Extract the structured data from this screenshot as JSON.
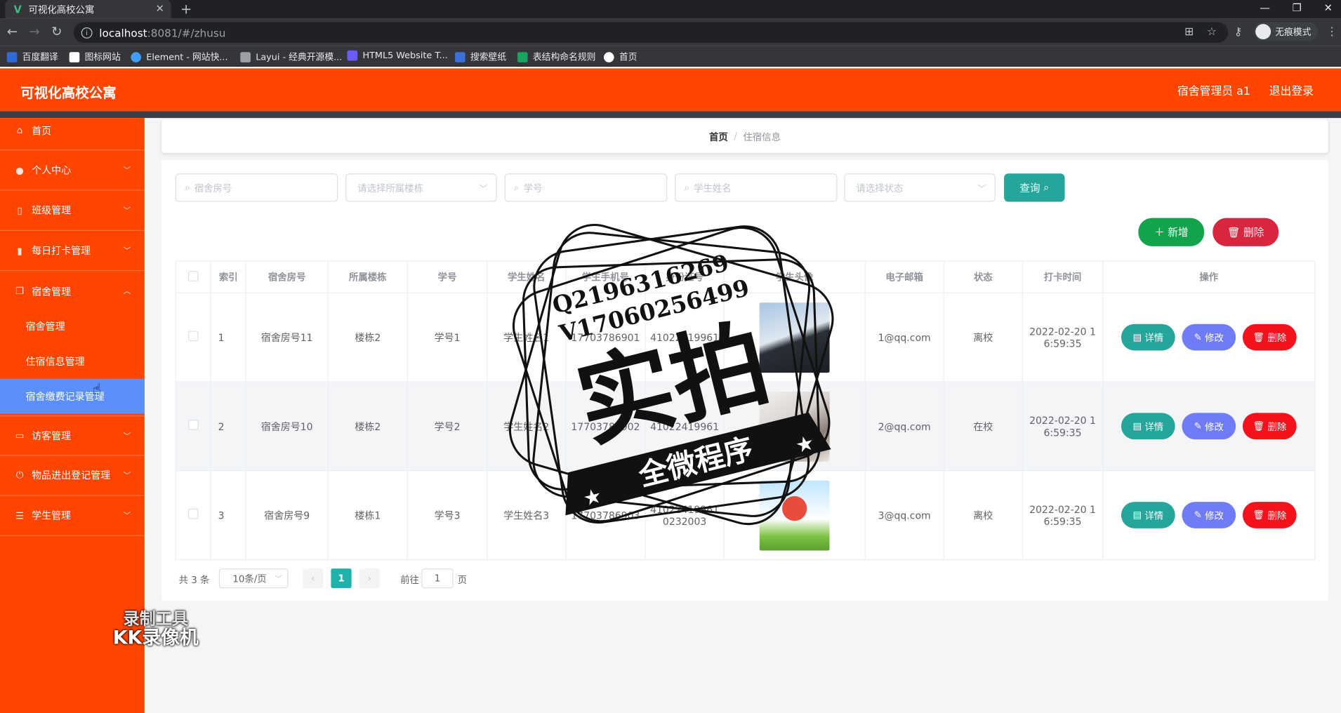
{
  "browser": {
    "tab_title": "可视化高校公寓",
    "url_host": "localhost",
    "url_path": ":8081/#/zhusu",
    "incognito_label": "无痕模式",
    "bookmarks": [
      "百度翻译",
      "图标网站",
      "Element - 网站快...",
      "Layui - 经典开源模...",
      "HTML5 Website T...",
      "搜索壁纸",
      "表结构命名规则",
      "首页"
    ]
  },
  "header": {
    "brand": "可视化高校公寓",
    "user": "宿舍管理员 a1",
    "logout": "退出登录"
  },
  "sidebar": {
    "items": [
      {
        "label": "首页",
        "icon": "home-icon"
      },
      {
        "label": "个人中心",
        "icon": "user-icon"
      },
      {
        "label": "班级管理",
        "icon": "phone-icon"
      },
      {
        "label": "每日打卡管理",
        "icon": "bar-chart-icon"
      },
      {
        "label": "宿舍管理",
        "icon": "copy-icon"
      },
      {
        "label": "访客管理",
        "icon": "monitor-icon"
      },
      {
        "label": "物品进出登记管理",
        "icon": "power-icon"
      },
      {
        "label": "学生管理",
        "icon": "sliders-icon"
      }
    ],
    "subitems": [
      "宿舍管理",
      "住宿信息管理",
      "宿舍缴费记录管理"
    ]
  },
  "breadcrumb": {
    "home": "首页",
    "sep": "/",
    "current": "住宿信息"
  },
  "filters": {
    "room_placeholder": "宿舍房号",
    "building_placeholder": "请选择所属楼栋",
    "student_no_placeholder": "学号",
    "student_name_placeholder": "学生姓名",
    "status_placeholder": "请选择状态",
    "query_label": "查询"
  },
  "actions": {
    "add": "新增",
    "delete": "删除"
  },
  "table": {
    "headers": [
      "索引",
      "宿舍房号",
      "所属楼栋",
      "学号",
      "学生姓名",
      "学生手机号",
      "身份证号",
      "学生头像",
      "电子邮箱",
      "状态",
      "打卡时间",
      "操作"
    ],
    "rows": [
      {
        "index": "1",
        "room": "宿舍房号11",
        "building": "楼栋2",
        "no": "学号1",
        "name": "学生姓名1",
        "phone": "17703786901",
        "id_card": "41022419961",
        "email": "1@qq.com",
        "status": "离校",
        "time1": "2022-02-20 1",
        "time2": "6:59:35"
      },
      {
        "index": "2",
        "room": "宿舍房号10",
        "building": "楼栋2",
        "no": "学号2",
        "name": "学生姓名2",
        "phone": "17703786902",
        "id_card": "41022419961",
        "email": "2@qq.com",
        "status": "在校",
        "time1": "2022-02-20 1",
        "time2": "6:59:35"
      },
      {
        "index": "3",
        "room": "宿舍房号9",
        "building": "楼栋1",
        "no": "学号3",
        "name": "学生姓名3",
        "phone": "17703786903",
        "id_card": "41022419961",
        "id_card2": "0232003",
        "email": "3@qq.com",
        "status": "离校",
        "time1": "2022-02-20 1",
        "time2": "6:59:35"
      }
    ],
    "ops": {
      "detail": "详情",
      "edit": "修改",
      "remove": "删除"
    }
  },
  "pagination": {
    "total": "共 3 条",
    "page_size": "10条/页",
    "current": "1",
    "goto_label": "前往",
    "goto_value": "1",
    "page_unit": "页"
  },
  "watermark": {
    "line1": "Q2196316269",
    "line2": "V17060256499",
    "big": "实拍",
    "ribbon": "全微程序"
  },
  "recorder": {
    "line1": "录制工具",
    "line2": "KK录像机"
  },
  "colors": {
    "header": "#ff4500",
    "sidebar_active": "#5b8ff9",
    "query": "#26a69a",
    "add": "#13a34a",
    "delete": "#d7263d",
    "edit": "#6f7cf5",
    "remove": "#f5121c"
  }
}
